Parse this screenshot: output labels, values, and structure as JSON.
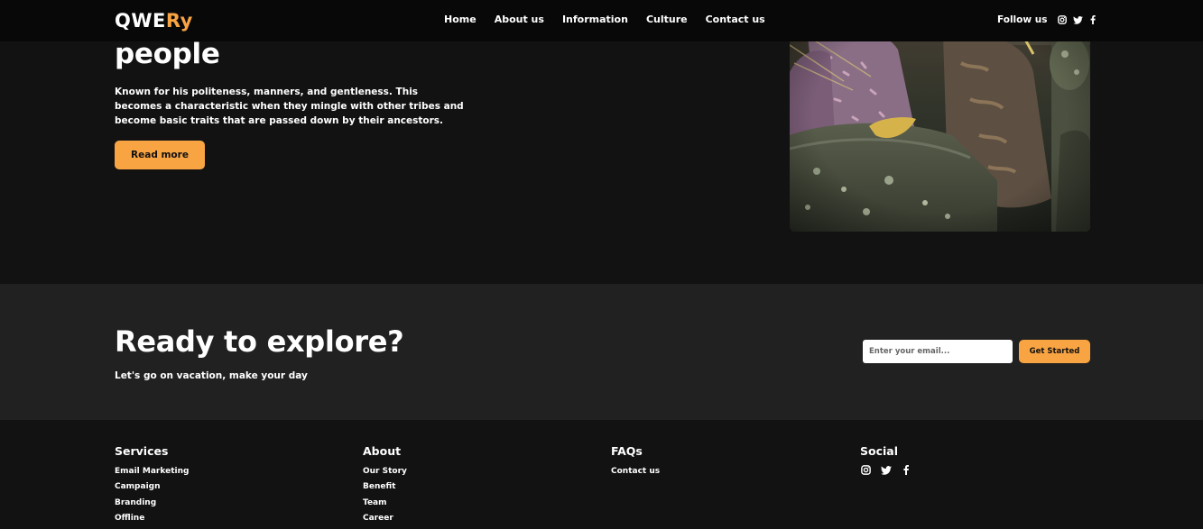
{
  "brand": {
    "part1": "QWE",
    "part2": "Ry"
  },
  "nav": {
    "links": [
      "Home",
      "About us",
      "Information",
      "Culture",
      "Contact us"
    ],
    "follow_label": "Follow us",
    "social_icons": [
      "instagram-icon",
      "twitter-icon",
      "facebook-icon"
    ]
  },
  "hero": {
    "title": "people",
    "description": "Known for his politeness, manners, and gentleness. This becomes a characteristic when they mingle with other tribes and become basic traits that are passed down by their ancestors.",
    "button_label": "Read more",
    "image": "photo of people weaving on mossy stones"
  },
  "explore": {
    "title": "Ready to explore?",
    "subtitle": "Let's go on vacation, make your day",
    "email_placeholder": "Enter your email...",
    "button_label": "Get Started"
  },
  "footer": {
    "columns": [
      {
        "heading": "Services",
        "items": [
          "Email Marketing",
          "Campaign",
          "Branding",
          "Offline"
        ]
      },
      {
        "heading": "About",
        "items": [
          "Our Story",
          "Benefit",
          "Team",
          "Career"
        ]
      },
      {
        "heading": "FAQs",
        "items": [
          "Contact us"
        ]
      },
      {
        "heading": "Social",
        "items": []
      }
    ],
    "social_icons": [
      "instagram-icon",
      "twitter-icon",
      "facebook-icon"
    ]
  },
  "colors": {
    "accent": "#f9a443",
    "background": "#121212",
    "navbar": "#080808",
    "band": "#212121"
  }
}
